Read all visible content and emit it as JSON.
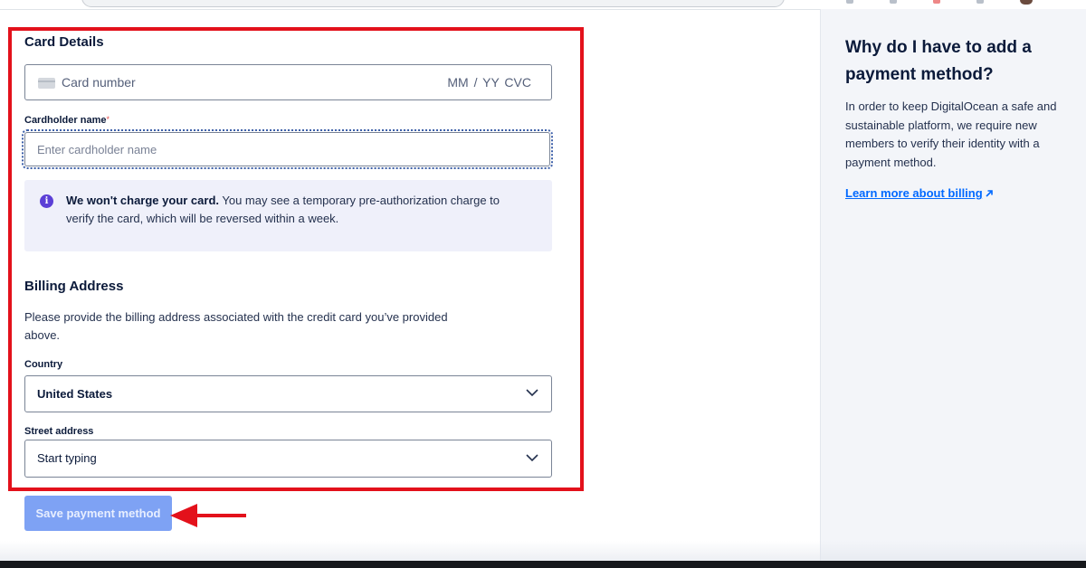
{
  "form": {
    "card_section_title": "Card Details",
    "card_number_placeholder": "Card number",
    "card_expiry_cvc": "MM / YY  CVC",
    "cardholder_label": "Cardholder name",
    "required_mark": "*",
    "cardholder_placeholder": "Enter cardholder name",
    "info_bold": "We won't charge your card.",
    "info_rest": " You may see a temporary pre-authorization charge to verify the card, which will be reversed within a week.",
    "billing_title": "Billing Address",
    "billing_description": "Please provide the billing address associated with the credit card you’ve provided above.",
    "country_label": "Country",
    "country_value": "United States",
    "street_label": "Street address",
    "street_placeholder": "Start typing",
    "save_label": "Save payment method"
  },
  "sidebar": {
    "title": "Why do I have to add a payment method?",
    "body": "In order to keep DigitalOcean a safe and sustainable platform, we require new members to verify their identity with a payment method.",
    "link": "Learn more about billing"
  },
  "colors": {
    "highlight": "#e3111b",
    "button": "#7ea2f4",
    "link": "#0069ff",
    "info_icon": "#5b3fd6",
    "sidebar_bg": "#f3f5f9"
  },
  "icons": {
    "card": "credit-card-icon",
    "info": "info-icon",
    "chevron": "chevron-down-icon",
    "external": "external-link-icon",
    "arrow": "red-arrow-annotation"
  }
}
